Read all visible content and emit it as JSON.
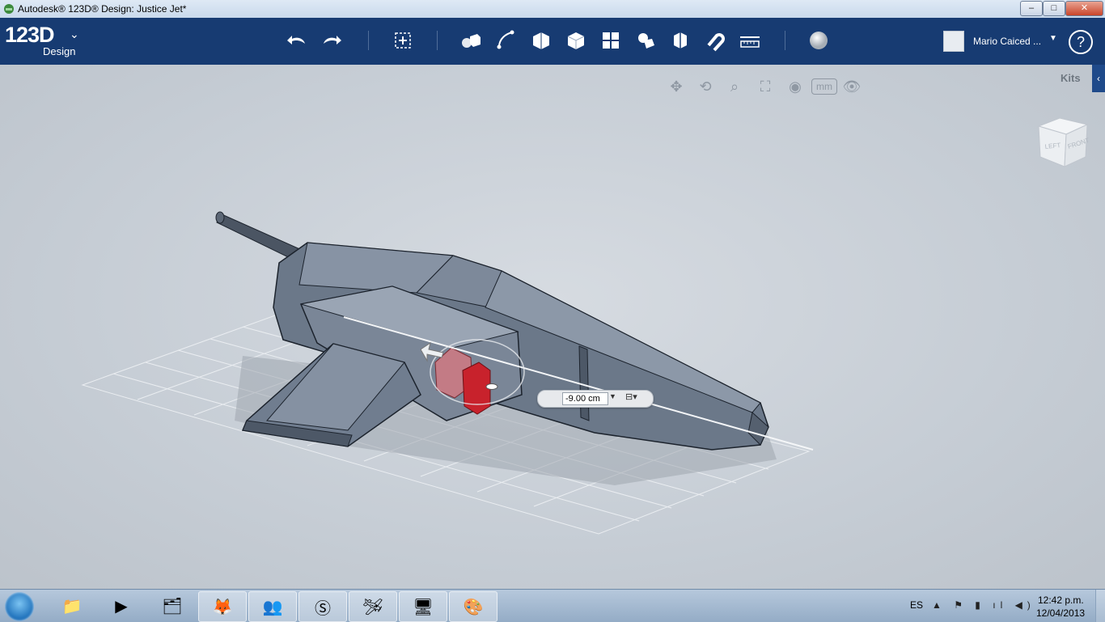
{
  "window": {
    "title": "Autodesk® 123D® Design: Justice Jet*",
    "min": "–",
    "max": "□",
    "close": "✕"
  },
  "logo": {
    "main": "123D",
    "sub": "Design",
    "chevron": "⌄"
  },
  "toolbar": {
    "tools": [
      "undo-icon",
      "redo-icon",
      "transform-icon",
      "primitives-icon",
      "sketch-icon",
      "construct-icon",
      "modify-icon",
      "pattern-icon",
      "grouping-icon",
      "combine-icon",
      "snap-icon",
      "measure-icon",
      "material-icon"
    ]
  },
  "user": {
    "name": "Mario Caiced ...",
    "dropdown": "▼"
  },
  "help": {
    "label": "?"
  },
  "viewport": {
    "kits": "Kits",
    "kits_tab": "‹",
    "units": "mm",
    "viewcube": {
      "left": "LEFT",
      "front": "FRONT"
    },
    "measure": {
      "value": "-9.00 cm",
      "dropdown": "▼"
    }
  },
  "taskbar": {
    "lang": "ES",
    "tray": "▲ ⚑ ▮ ıl ◀)",
    "time": "12:42 p.m.",
    "date": "12/04/2013"
  },
  "colors": {
    "toolbar": "#173b72",
    "accent": "#1f4a8a",
    "model": "#6b7a8d",
    "selection": "#c8222c"
  }
}
